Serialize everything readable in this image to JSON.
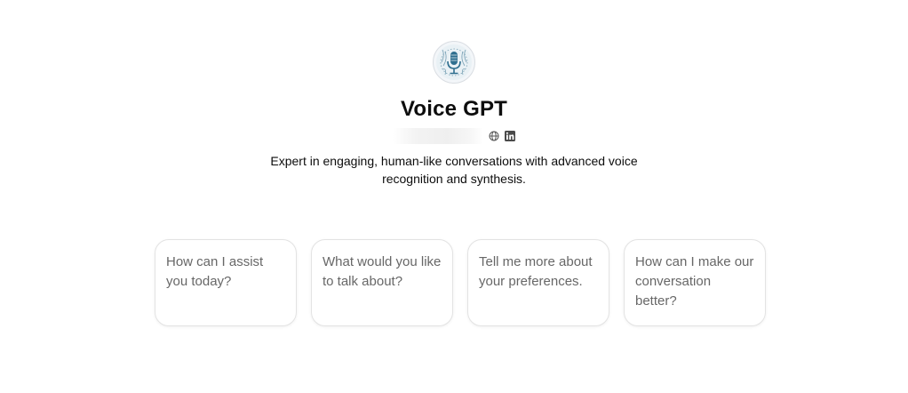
{
  "gpt": {
    "name": "Voice GPT",
    "description": "Expert in engaging, human-like conversations with advanced voice recognition and synthesis.",
    "avatar_icon": "microphone-icon",
    "byline_icons": [
      "globe-icon",
      "linkedin-icon"
    ]
  },
  "starters": [
    {
      "text": "How can I assist you today?"
    },
    {
      "text": "What would you like to talk about?"
    },
    {
      "text": "Tell me more about your preferences."
    },
    {
      "text": "How can I make our conversation better?"
    }
  ],
  "colors": {
    "text_primary": "#0d0d0d",
    "text_secondary": "#676767",
    "card_border": "#e3e3e3",
    "avatar_accent": "#2f6f8f"
  }
}
